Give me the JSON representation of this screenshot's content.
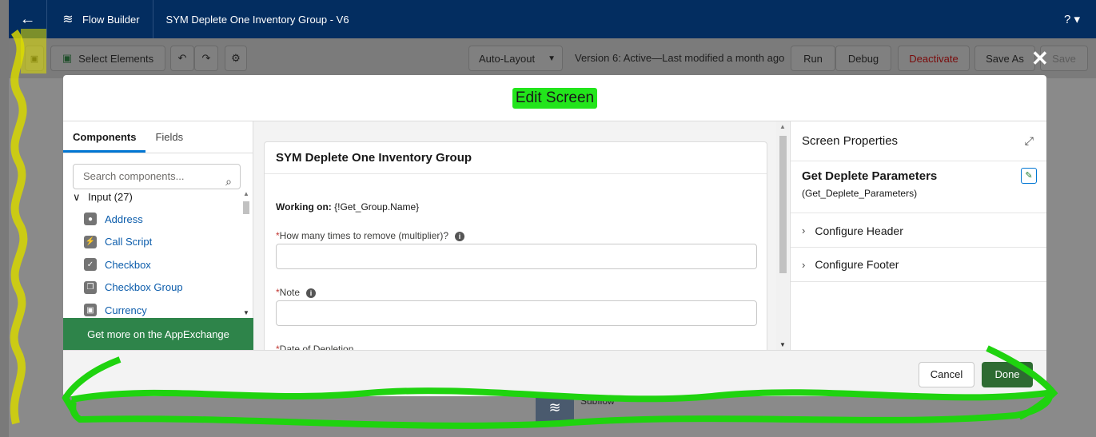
{
  "header": {
    "back_icon": "back-arrow-icon",
    "app_name": "Flow Builder",
    "flow_name": "SYM Deplete One Inventory Group - V6",
    "help": "? ▾"
  },
  "toolbar": {
    "select_elements": "Select Elements",
    "layout": "Auto-Layout",
    "version_status": "Version 6: Active—Last modified a month ago",
    "run": "Run",
    "debug": "Debug",
    "deactivate": "Deactivate",
    "save_as": "Save As",
    "save": "Save"
  },
  "modal": {
    "title": "Edit Screen",
    "tabs": [
      "Components",
      "Fields"
    ],
    "search_placeholder": "Search components...",
    "tree_group": "Input (27)",
    "components": [
      {
        "label": "Address",
        "icon": "address-icon"
      },
      {
        "label": "Call Script",
        "icon": "call-script-icon"
      },
      {
        "label": "Checkbox",
        "icon": "checkbox-icon"
      },
      {
        "label": "Checkbox Group",
        "icon": "checkbox-group-icon"
      },
      {
        "label": "Currency",
        "icon": "currency-icon"
      }
    ],
    "appexchange": "Get more on the AppExchange",
    "canvas": {
      "screen_title": "SYM Deplete One Inventory Group",
      "working_label": "Working on:",
      "working_value": " {!Get_Group.Name}",
      "field1_label": "How many times to remove (multiplier)?",
      "field2_label": "Note",
      "field3_label": "Date of Depletion",
      "required_mark": "*"
    },
    "properties": {
      "header": "Screen Properties",
      "name": "Get Deplete Parameters",
      "api_name": "(Get_Deplete_Parameters)",
      "sections": [
        "Configure Header",
        "Configure Footer"
      ]
    },
    "footer": {
      "cancel": "Cancel",
      "done": "Done"
    }
  },
  "background": {
    "subflow_label": "Subflow"
  },
  "colors": {
    "header_bg": "#032d60",
    "appexchange_bg": "#2e844a",
    "highlight_green": "#22e51b",
    "scribble_green": "#1fd30f",
    "scribble_yellow": "#d6d600"
  }
}
